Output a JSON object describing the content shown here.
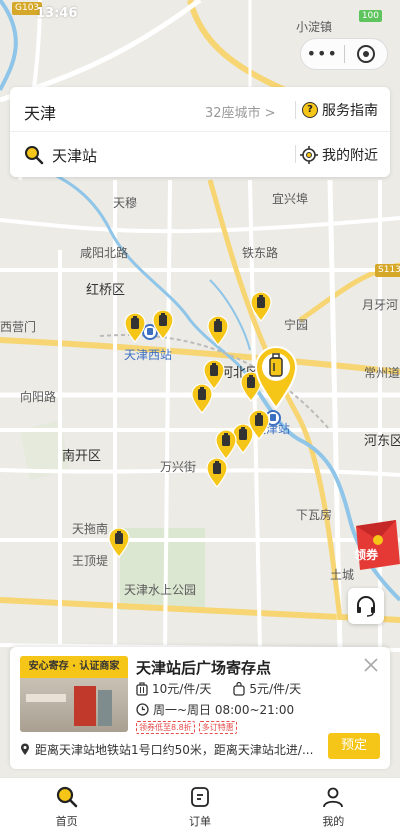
{
  "status_bar": {
    "time": "13:46",
    "battery": "100"
  },
  "search": {
    "city": "天津",
    "city_count": "32座城市 >",
    "guide_label": "服务指南",
    "query": "天津站",
    "nearby_label": "我的附近"
  },
  "map": {
    "road_tags": [
      "G103",
      "S113"
    ],
    "labels": [
      "天穆",
      "宜兴埠",
      "小淀镇",
      "咸阳北路",
      "铁东路",
      "红桥区",
      "月牙河",
      "西营门",
      "宁园",
      "天津西站",
      "河北区",
      "常州道",
      "向阳路",
      "天津站",
      "河东区",
      "南开区",
      "万兴街",
      "下瓦房",
      "天拖南",
      "王顶堤",
      "天津水上公园",
      "土城"
    ]
  },
  "coupon_label": "领券",
  "store": {
    "image_banner": "安心寄存 · 认证商家",
    "name": "天津站后广场寄存点",
    "price_large": "10元/件/天",
    "price_small": "5元/件/天",
    "hours": "周一~周日 08:00~21:00",
    "tags": [
      "领券低至8.8折",
      "多订特惠"
    ],
    "address": "距离天津站地铁站1号口约50米，距离天津站北进/...",
    "book_label": "预定"
  },
  "tabs": [
    {
      "label": "首页",
      "icon": "search-icon"
    },
    {
      "label": "订单",
      "icon": "order-icon"
    },
    {
      "label": "我的",
      "icon": "user-icon"
    }
  ],
  "colors": {
    "accent": "#f5c518",
    "river": "#8ec5e8"
  }
}
